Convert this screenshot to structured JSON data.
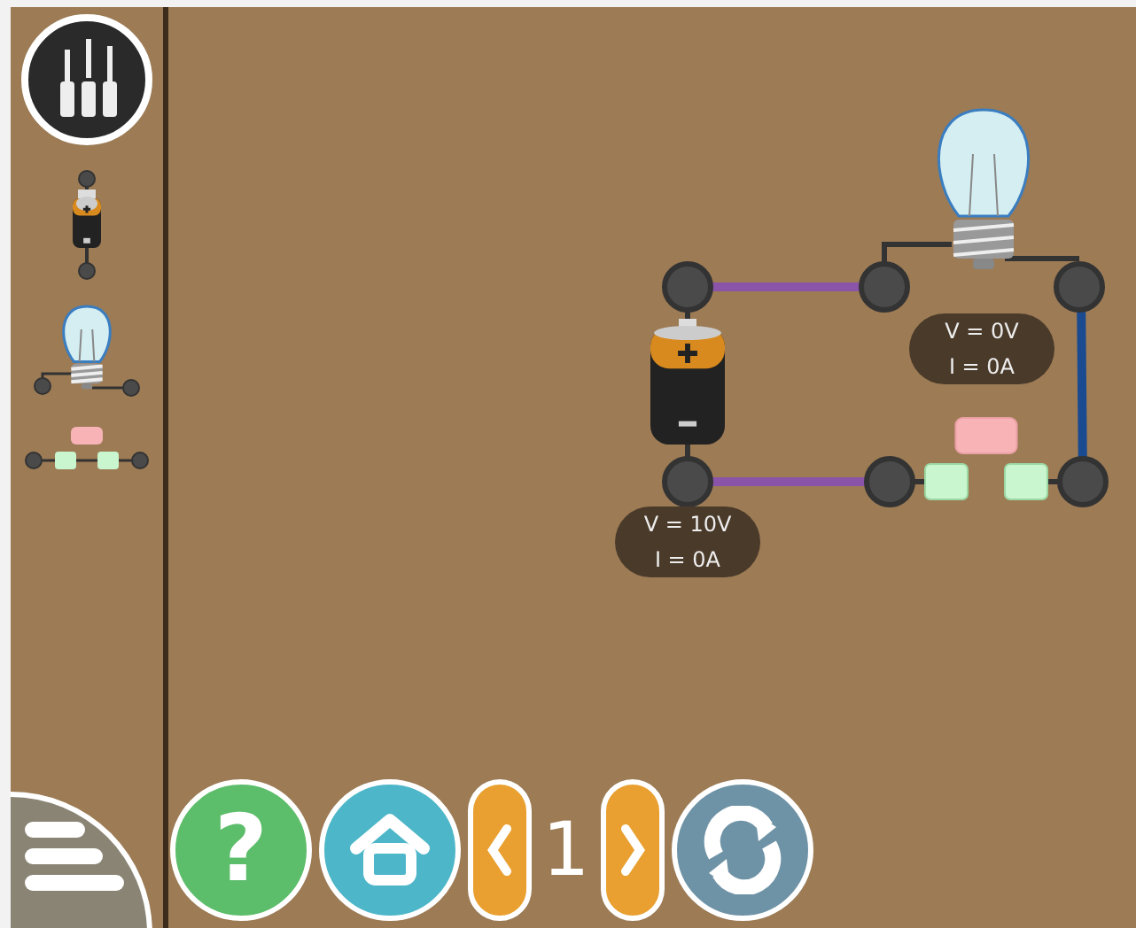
{
  "sidebar": {
    "toolbox_button": {
      "selected": false
    },
    "parts": [
      {
        "kind": "battery"
      },
      {
        "kind": "bulb"
      },
      {
        "kind": "switch"
      }
    ]
  },
  "circuit": {
    "battery_readout": {
      "voltage": "V = 10V",
      "current": "I = 0A"
    },
    "bulb_readout": {
      "voltage": "V = 0V",
      "current": "I = 0A"
    },
    "switch": {
      "closed": false
    }
  },
  "toolbar": {
    "help": "?",
    "page": "1"
  }
}
